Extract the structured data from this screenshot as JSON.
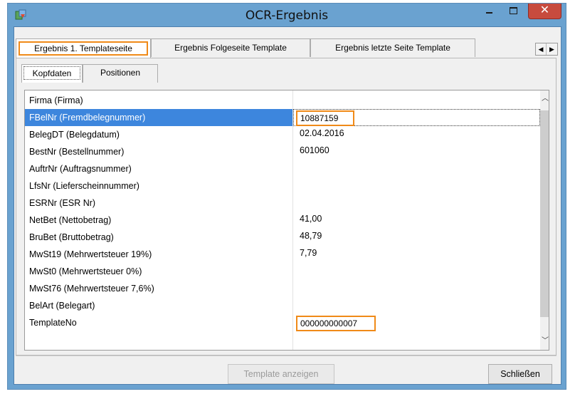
{
  "window": {
    "title": "OCR-Ergebnis",
    "close_glyph": "✕"
  },
  "tabs": [
    {
      "label": "Ergebnis 1. Templateseite",
      "active": true
    },
    {
      "label": "Ergebnis Folgeseite Template",
      "active": false
    },
    {
      "label": "Ergebnis letzte Seite Template",
      "active": false
    }
  ],
  "subtabs": [
    {
      "label": "Kopfdaten",
      "active": true
    },
    {
      "label": "Positionen",
      "active": false
    }
  ],
  "rows": [
    {
      "name": "Firma (Firma)",
      "value": ""
    },
    {
      "name": "FBelNr (Fremdbelegnummer)",
      "value": "10887159"
    },
    {
      "name": "BelegDT (Belegdatum)",
      "value": "02.04.2016"
    },
    {
      "name": "BestNr (Bestellnummer)",
      "value": "601060"
    },
    {
      "name": "AuftrNr (Auftragsnummer)",
      "value": ""
    },
    {
      "name": "LfsNr (Lieferscheinnummer)",
      "value": ""
    },
    {
      "name": "ESRNr (ESR Nr)",
      "value": ""
    },
    {
      "name": "NetBet (Nettobetrag)",
      "value": "41,00"
    },
    {
      "name": "BruBet (Bruttobetrag)",
      "value": "48,79"
    },
    {
      "name": "MwSt19 (Mehrwertsteuer 19%)",
      "value": "7,79"
    },
    {
      "name": "MwSt0 (Mehrwertsteuer 0%)",
      "value": ""
    },
    {
      "name": "MwSt76 (Mehrwertsteuer 7,6%)",
      "value": ""
    },
    {
      "name": "BelArt (Belegart)",
      "value": ""
    },
    {
      "name": "TemplateNo",
      "value": "000000000007"
    }
  ],
  "selected_row": "FBelNr (Fremdbelegnummer)",
  "highlight_color": "#f08a18",
  "selection_color": "#3d86dd",
  "buttons": {
    "show_template": "Template anzeigen",
    "close": "Schließen"
  }
}
